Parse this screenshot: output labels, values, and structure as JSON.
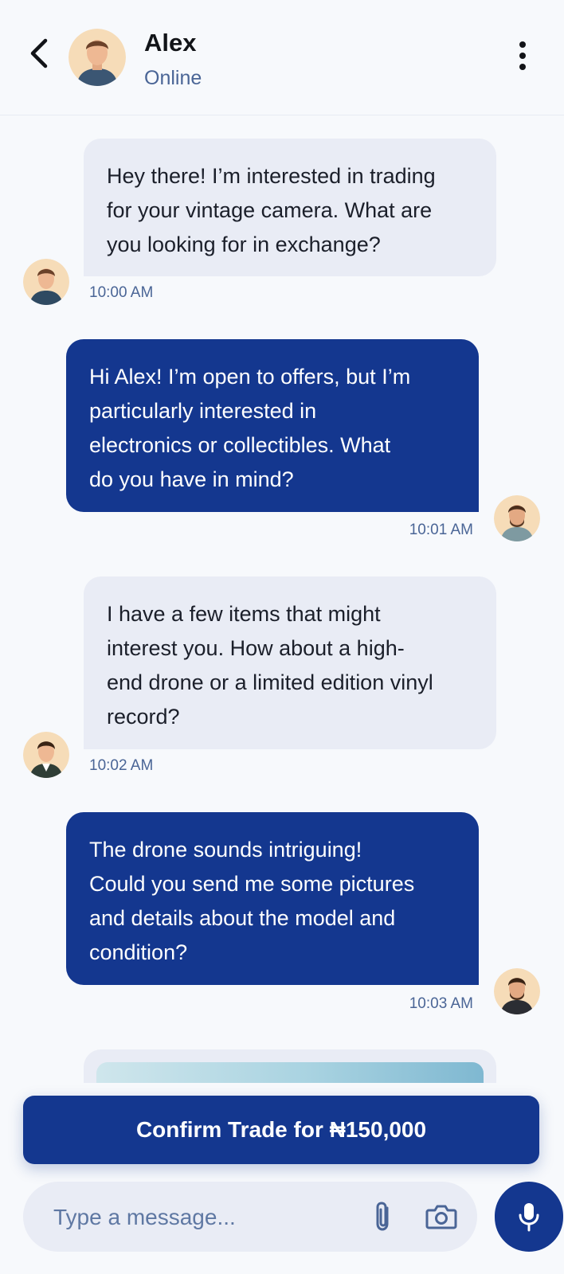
{
  "header": {
    "name": "Alex",
    "status": "Online"
  },
  "messages": [
    {
      "direction": "incoming",
      "lines": [
        "Hey there! I’m interested in trading",
        "for your vintage camera. What are",
        "you looking for in exchange?"
      ],
      "time": "10:00 AM"
    },
    {
      "direction": "outgoing",
      "lines": [
        "Hi Alex! I’m open to offers, but I’m",
        "particularly interested in",
        "electronics or collectibles. What",
        "do you have in mind?"
      ],
      "time": "10:01 AM"
    },
    {
      "direction": "incoming",
      "lines": [
        "I have a few items that might",
        "interest you. How about a high-",
        "end drone or a limited edition vinyl",
        "record?"
      ],
      "time": "10:02 AM"
    },
    {
      "direction": "outgoing",
      "lines": [
        "The drone sounds intriguing!",
        "Could you send me some pictures",
        "and details about the model and",
        "condition?"
      ],
      "time": "10:03 AM"
    }
  ],
  "confirm": {
    "label": "Confirm Trade for ₦150,000"
  },
  "composer": {
    "placeholder": "Type a message..."
  },
  "icons": {
    "back": "chevron-left-icon",
    "menu": "more-vertical-icon",
    "attach": "paperclip-icon",
    "camera": "camera-icon",
    "mic": "microphone-icon"
  },
  "colors": {
    "primary": "#14378f",
    "incoming_bubble": "#e9ecf5",
    "muted_text": "#4a6596",
    "background": "#f7f9fc"
  }
}
